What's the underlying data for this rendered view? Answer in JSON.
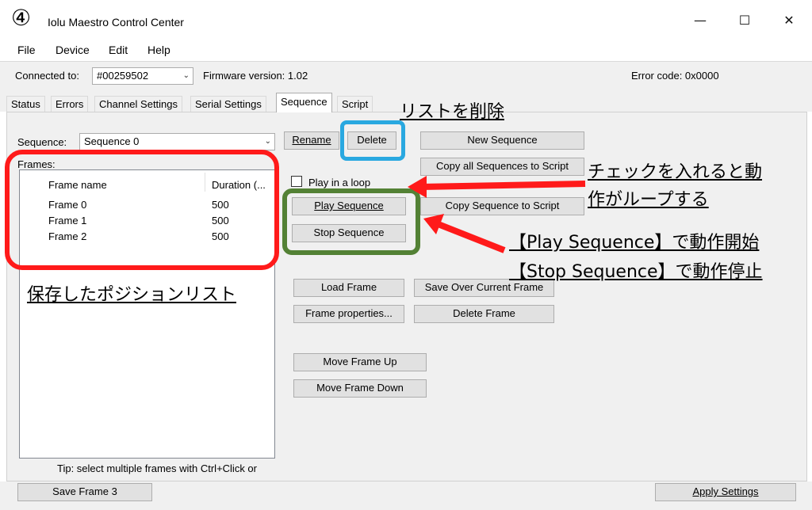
{
  "step_number": "④",
  "window": {
    "title": "Iolu Maestro Control Center",
    "minimize": "—",
    "maximize": "☐",
    "close": "✕"
  },
  "menu": [
    "File",
    "Device",
    "Edit",
    "Help"
  ],
  "connection": {
    "label": "Connected to:",
    "device": "#00259502",
    "firmware": "Firmware version: 1.02",
    "error": "Error code:  0x0000"
  },
  "tabs": [
    "Status",
    "Errors",
    "Channel Settings",
    "Serial Settings",
    "Sequence",
    "Script"
  ],
  "active_tab": "Sequence",
  "sequence": {
    "label": "Sequence:",
    "selected": "Sequence 0",
    "rename": "Rename",
    "delete": "Delete",
    "new": "New Sequence",
    "copy_all": "Copy all Sequences to Script",
    "copy_one": "Copy Sequence to Script",
    "loop_label": "Play in a loop",
    "loop_checked": false,
    "play": "Play Sequence",
    "stop": "Stop Sequence"
  },
  "frames": {
    "label": "Frames:",
    "col_name": "Frame name",
    "col_duration": "Duration (...",
    "rows": [
      {
        "name": "Frame 0",
        "duration": "500"
      },
      {
        "name": "Frame 1",
        "duration": "500"
      },
      {
        "name": "Frame 2",
        "duration": "500"
      }
    ],
    "tip": "Tip: select multiple frames with Ctrl+Click or"
  },
  "frame_buttons": {
    "load": "Load Frame",
    "save_over": "Save Over Current Frame",
    "properties": "Frame properties...",
    "delete": "Delete Frame",
    "move_up": "Move Frame Up",
    "move_down": "Move Frame Down"
  },
  "bottom": {
    "save_frame": "Save Frame 3",
    "apply": "Apply Settings"
  },
  "annotations": {
    "delete_list": "リストを削除",
    "loop_note_1": "チェックを入れると動",
    "loop_note_2": "作がループする",
    "play_note": "【Play Sequence】で動作開始",
    "stop_note": "【Stop Sequence】で動作停止",
    "saved_list": "保存したポジションリスト"
  },
  "colors": {
    "annotation_red": "#ff1a1a",
    "annotation_blue": "#29a8e0",
    "annotation_green": "#538135"
  }
}
